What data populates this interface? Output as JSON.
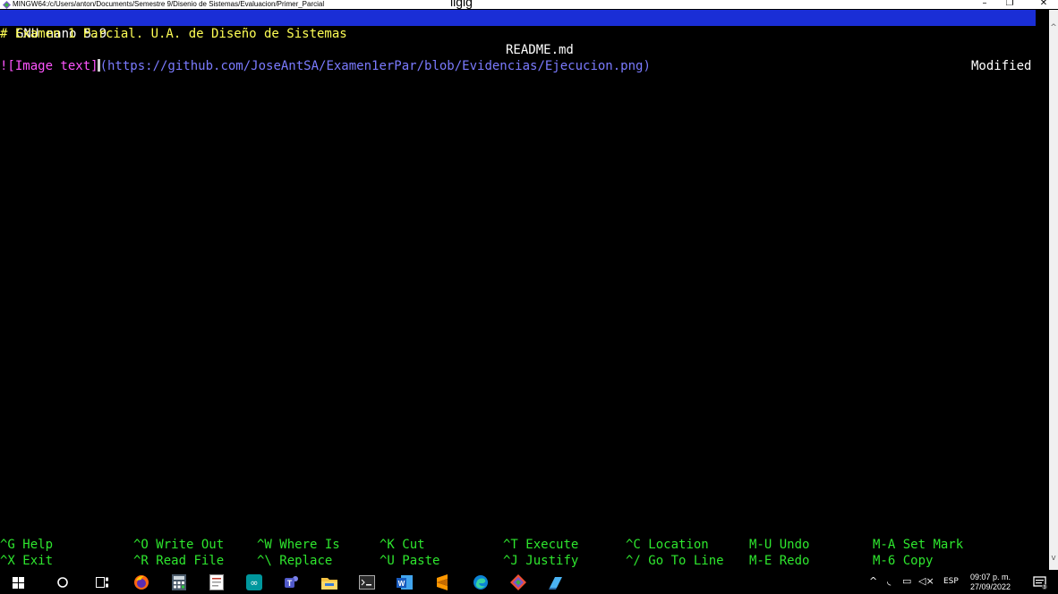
{
  "window": {
    "title_path": "MINGW64:/c/Users/anton/Documents/Semestre 9/Disenio de Sistemas/Evaluacion/Primer_Parcial",
    "overlap_text": "ligig",
    "buttons": {
      "minimize": "–",
      "restore": "❐",
      "close": "✕"
    }
  },
  "nano": {
    "version": "GNU nano 5.9",
    "filename": "README.md",
    "status": "Modified"
  },
  "content": {
    "line1": "# Examen 1 Parcial. U.A. de Diseño de Sistemas",
    "line3_img": "![Image text]",
    "line3_url": "(https://github.com/JoseAntSA/Examen1erPar/blob/Evidencias/Ejecucion.png)"
  },
  "shortcuts": [
    {
      "key": "^G",
      "label": "Help"
    },
    {
      "key": "^X",
      "label": "Exit"
    },
    {
      "key": "^O",
      "label": "Write Out"
    },
    {
      "key": "^R",
      "label": "Read File"
    },
    {
      "key": "^W",
      "label": "Where Is"
    },
    {
      "key": "^\\",
      "label": "Replace"
    },
    {
      "key": "^K",
      "label": "Cut"
    },
    {
      "key": "^U",
      "label": "Paste"
    },
    {
      "key": "^T",
      "label": "Execute"
    },
    {
      "key": "^J",
      "label": "Justify"
    },
    {
      "key": "^C",
      "label": "Location"
    },
    {
      "key": "^/",
      "label": "Go To Line"
    },
    {
      "key": "M-U",
      "label": "Undo"
    },
    {
      "key": "M-E",
      "label": "Redo"
    },
    {
      "key": "M-A",
      "label": "Set Mark"
    },
    {
      "key": "M-6",
      "label": "Copy"
    }
  ],
  "taskbar": {
    "language": "ESP",
    "time": "09:07 p. m.",
    "date": "27/09/2022",
    "notification_count": "3",
    "icons": [
      "windows-start-icon",
      "search-icon",
      "task-view-icon",
      "firefox-icon",
      "calculator-icon",
      "notepad-icon",
      "arduino-icon",
      "teams-icon",
      "file-explorer-icon",
      "terminal-icon",
      "word-icon",
      "sublime-icon",
      "edge-icon",
      "git-icon",
      "app-icon"
    ],
    "colors": {
      "background": "#000000",
      "nano_bar": "#1a2ed6",
      "heading": "#ffff55",
      "link_text": "#ff55ff",
      "url": "#7b7bff",
      "shortcut": "#2ee62e"
    }
  }
}
